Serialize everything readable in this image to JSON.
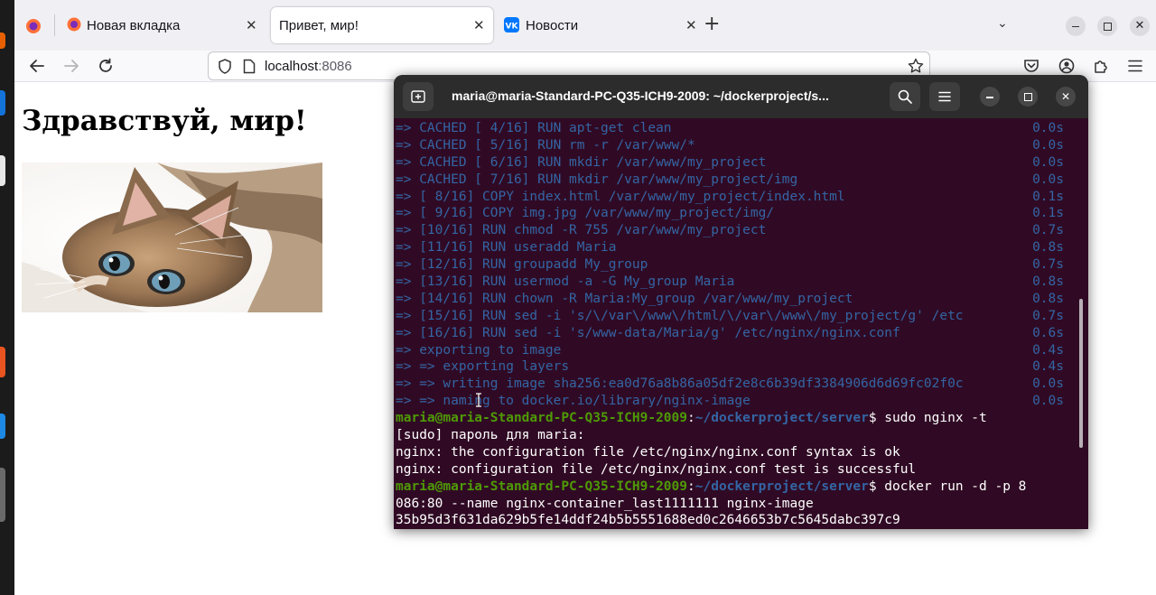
{
  "browser": {
    "tabs": [
      {
        "label": "Новая вкладка",
        "active": false
      },
      {
        "label": "Привет, мир!",
        "active": true
      },
      {
        "label": "Новости",
        "active": false
      }
    ],
    "address": {
      "host": "localhost",
      "port": ":8086"
    }
  },
  "page": {
    "heading": "Здравствуй, мир!",
    "image_alt": "kitten"
  },
  "terminal": {
    "title": "maria@maria-Standard-PC-Q35-ICH9-2009: ~/dockerproject/s...",
    "build_lines": [
      {
        "text": "=> CACHED [ 4/16] RUN apt-get clean",
        "time": "0.0s"
      },
      {
        "text": "=> CACHED [ 5/16] RUN rm -r /var/www/*",
        "time": "0.0s"
      },
      {
        "text": "=> CACHED [ 6/16] RUN mkdir /var/www/my_project",
        "time": "0.0s"
      },
      {
        "text": "=> CACHED [ 7/16] RUN mkdir /var/www/my_project/img",
        "time": "0.0s"
      },
      {
        "text": "=> [ 8/16] COPY index.html /var/www/my_project/index.html",
        "time": "0.1s"
      },
      {
        "text": "=> [ 9/16] COPY img.jpg /var/www/my_project/img/",
        "time": "0.1s"
      },
      {
        "text": "=> [10/16] RUN chmod -R 755 /var/www/my_project",
        "time": "0.7s"
      },
      {
        "text": "=> [11/16] RUN useradd Maria",
        "time": "0.8s"
      },
      {
        "text": "=> [12/16] RUN groupadd My_group",
        "time": "0.7s"
      },
      {
        "text": "=> [13/16] RUN usermod -a -G My_group Maria",
        "time": "0.8s"
      },
      {
        "text": "=> [14/16] RUN chown -R Maria:My_group /var/www/my_project",
        "time": "0.8s"
      },
      {
        "text": "=> [15/16] RUN sed -i 's/\\/var\\/www\\/html/\\/var\\/www\\/my_project/g' /etc",
        "time": "0.7s"
      },
      {
        "text": "=> [16/16] RUN sed -i 's/www-data/Maria/g' /etc/nginx/nginx.conf",
        "time": "0.6s"
      },
      {
        "text": "=> exporting to image",
        "time": "0.4s"
      },
      {
        "text": "=> => exporting layers",
        "time": "0.4s"
      },
      {
        "text": "=> => writing image sha256:ea0d76a8b86a05df2e8c6b39df3384906d6d69fc02f0c",
        "time": "0.0s"
      },
      {
        "text": "=> => naming to docker.io/library/nginx-image",
        "time": "0.0s"
      }
    ],
    "prompt_user": "maria@maria-Standard-PC-Q35-ICH9-2009",
    "prompt_path": "~/dockerproject/server",
    "cmd1": "sudo nginx -t",
    "out1": "[sudo] пароль для maria:",
    "out2": "nginx: the configuration file /etc/nginx/nginx.conf syntax is ok",
    "out3": "nginx: configuration file /etc/nginx/nginx.conf test is successful",
    "cmd2": "docker run -d -p 8",
    "cmd2_wrap": "086:80 --name nginx-container_last1111111 nginx-image",
    "out4": "35b95d3f631da629b5fe14ddf24b5b5551688ed0c2646653b7c5645dabc397c9"
  },
  "colors": {
    "terminal_bg": "#300a24",
    "prompt_user": "#4e9a06",
    "prompt_path": "#3465a4",
    "build_text": "#3465a4"
  }
}
